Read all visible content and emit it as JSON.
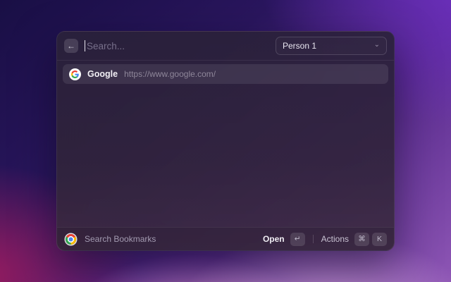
{
  "window": {
    "header": {
      "back_button": {
        "icon": "arrow-left",
        "glyph": "←"
      },
      "search": {
        "placeholder": "Search...",
        "value": ""
      },
      "profile_dropdown": {
        "value": "Person 1",
        "chevron_glyph": "⌄"
      }
    },
    "results": [
      {
        "icon": "google-logo",
        "title": "Google",
        "url": "https://www.google.com/",
        "selected": true
      }
    ],
    "footer": {
      "source_icon": "chrome-logo",
      "source_label": "Search Bookmarks",
      "primary_action": {
        "label": "Open",
        "key": "↵"
      },
      "secondary_action": {
        "label": "Actions",
        "keys": [
          "⌘",
          "K"
        ]
      }
    }
  },
  "colors": {
    "window_bg": "#2e2440",
    "selection_bg": "#4a4157",
    "accent_text": "#efedf3",
    "muted_text": "#8e8699",
    "bg_gradient_top_left": "#190f45",
    "bg_gradient_top_right": "#7231c9",
    "bg_gradient_bottom_left": "#9c1b5e",
    "bg_gradient_bottom_right": "#9a6ec0"
  }
}
